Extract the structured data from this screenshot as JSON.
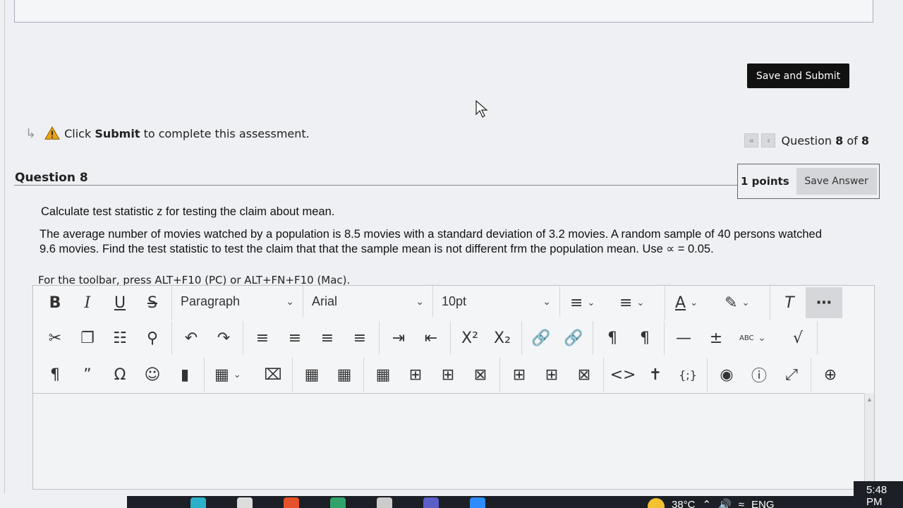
{
  "actions": {
    "save_submit": "Save and Submit"
  },
  "notice": {
    "prefix": "Click ",
    "bold": "Submit",
    "suffix": " to complete this assessment."
  },
  "nav": {
    "question_prefix": "Question ",
    "current": "8",
    "of": " of ",
    "total": "8"
  },
  "question": {
    "title": "Question 8",
    "points": "1 points",
    "save_answer": "Save Answer",
    "prompt": "Calculate test statistic z for testing the claim about mean.",
    "body": "The average number of movies watched by a population is 8.5 movies with a standard deviation of 3.2 movies. A random sample of 40 persons watched 9.6 movies. Find the test statistic to test the claim that that the sample mean is not different frm the population mean. Use ∝ = 0.05."
  },
  "editor": {
    "toolbar_hint": "For the toolbar, press ALT+F10 (PC) or ALT+FN+F10 (Mac).",
    "block_format": "Paragraph",
    "font_family": "Arial",
    "font_size": "10pt",
    "superscript": "X²",
    "subscript": "X₂",
    "spellcheck_label": "ABC"
  },
  "taskbar": {
    "temperature": "38°C",
    "language": "ENG",
    "time": "5:48 PM"
  },
  "colors": {
    "submit_bg": "#111111",
    "warning": "#e8a317",
    "page_bg": "#eef0f3"
  }
}
